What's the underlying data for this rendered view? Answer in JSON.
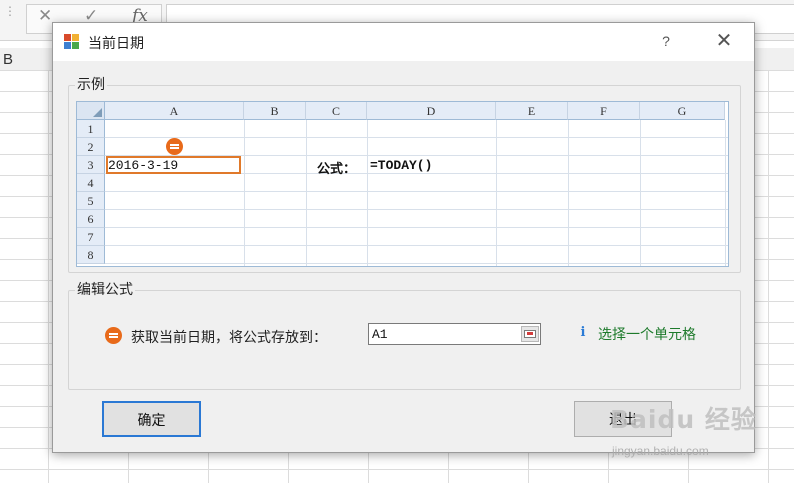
{
  "background": {
    "formula_cancel_icon": "close-icon",
    "formula_enter_icon": "check-icon",
    "formula_fx_label": "fx",
    "column_visible": "B"
  },
  "dialog": {
    "title": "当前日期",
    "help_label": "?",
    "close_label": "✕",
    "example_group_label": "示例",
    "preview": {
      "columns": [
        "A",
        "B",
        "C",
        "D",
        "E",
        "F",
        "G"
      ],
      "rows": [
        "1",
        "2",
        "3",
        "4",
        "5",
        "6",
        "7",
        "8"
      ],
      "cell_A3": "2016-3-19",
      "cell_C3": "公式：",
      "cell_D3": "=TODAY()"
    },
    "edit_group_label": "编辑公式",
    "field_label": "获取当前日期，将公式存放到：",
    "target_cell_value": "A1",
    "hint_text": "选择一个单元格",
    "ok_label": "确定",
    "exit_label": "退出"
  },
  "watermark": {
    "main": "Baidu 经验",
    "sub": "jingyan.baidu.com"
  },
  "colors": {
    "accent_orange": "#e86a1a",
    "ok_border": "#2a78d4",
    "hint_green": "#1d7a2b",
    "header_blue": "#e4ecf7"
  }
}
